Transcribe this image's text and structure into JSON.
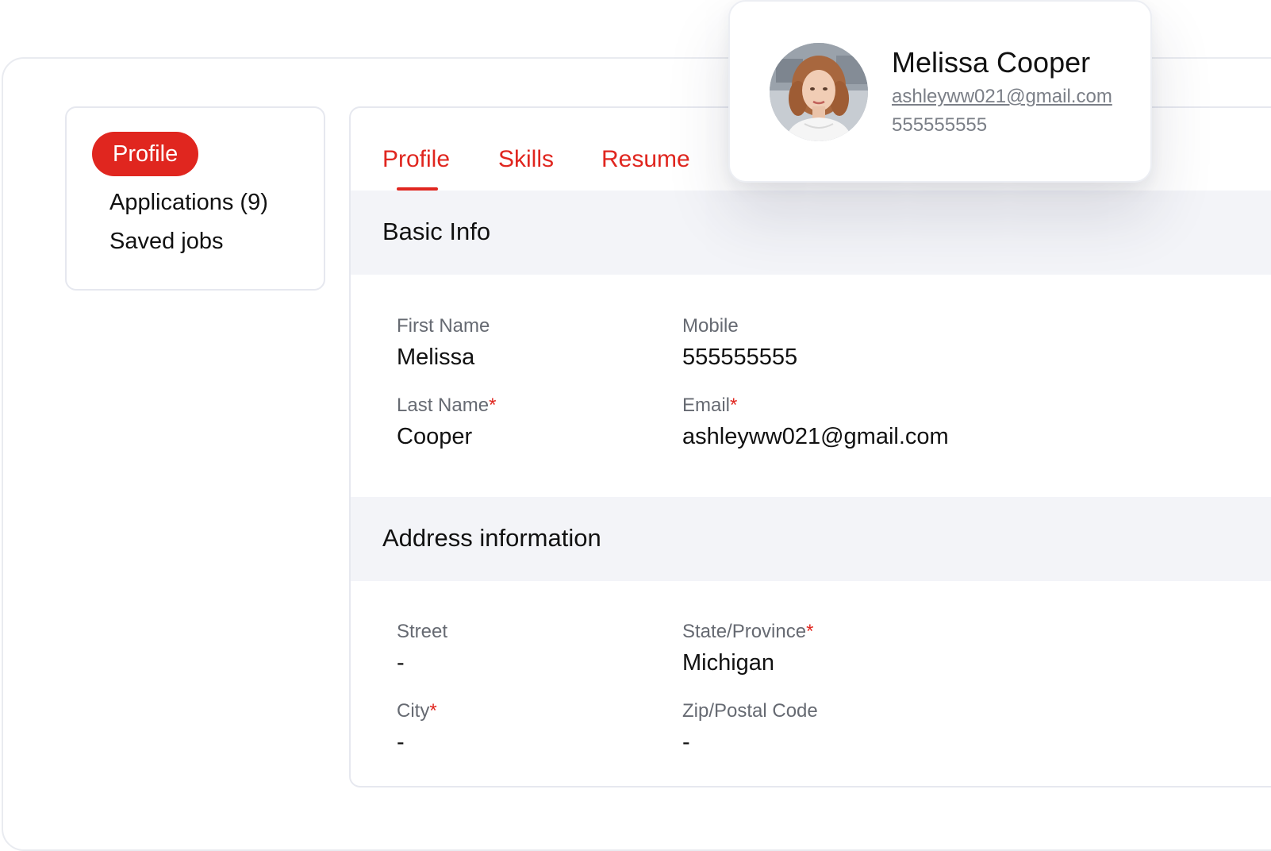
{
  "sidebar": {
    "items": [
      {
        "label": "Profile",
        "active": true
      },
      {
        "label": "Applications (9)",
        "active": false
      },
      {
        "label": "Saved jobs",
        "active": false
      }
    ]
  },
  "tabs": [
    {
      "label": "Profile",
      "active": true
    },
    {
      "label": "Skills",
      "active": false
    },
    {
      "label": "Resume",
      "active": false
    }
  ],
  "basic_info": {
    "title": "Basic Info",
    "fields": {
      "first_name": {
        "label": "First Name",
        "value": "Melissa",
        "required": false
      },
      "mobile": {
        "label": "Mobile",
        "value": "555555555",
        "required": false
      },
      "last_name": {
        "label": "Last Name",
        "value": "Cooper",
        "required": true
      },
      "email": {
        "label": "Email",
        "value": "ashleyww021@gmail.com",
        "required": true
      }
    }
  },
  "address_info": {
    "title": "Address information",
    "fields": {
      "street": {
        "label": "Street",
        "value": "-",
        "required": false
      },
      "state": {
        "label": "State/Province",
        "value": "Michigan",
        "required": true
      },
      "city": {
        "label": "City",
        "value": "-",
        "required": true
      },
      "zip": {
        "label": "Zip/Postal Code",
        "value": "-",
        "required": false
      }
    }
  },
  "profile_card": {
    "name": "Melissa Cooper",
    "email": "ashleyww021@gmail.com",
    "phone": "555555555"
  },
  "required_marker": "*",
  "colors": {
    "accent": "#e0261f",
    "section_bg": "#f3f4f8",
    "label_gray": "#666a72",
    "border": "#e6e8ef"
  }
}
